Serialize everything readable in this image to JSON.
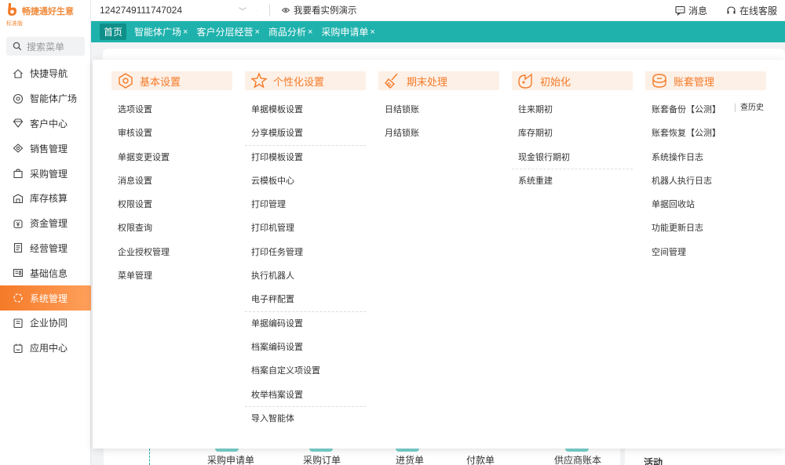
{
  "brand": {
    "name": "畅捷通好生意",
    "edition": "标准版"
  },
  "sidebar": {
    "search_placeholder": "搜索菜单",
    "items": [
      {
        "label": "快捷导航",
        "icon": "home-icon"
      },
      {
        "label": "智能体广场",
        "icon": "agent-icon"
      },
      {
        "label": "客户中心",
        "icon": "diamond-icon"
      },
      {
        "label": "销售管理",
        "icon": "sales-icon"
      },
      {
        "label": "采购管理",
        "icon": "bag-icon"
      },
      {
        "label": "库存核算",
        "icon": "warehouse-icon"
      },
      {
        "label": "资金管理",
        "icon": "money-icon"
      },
      {
        "label": "经营管理",
        "icon": "document-icon"
      },
      {
        "label": "基础信息",
        "icon": "info-card-icon"
      },
      {
        "label": "系统管理",
        "icon": "system-icon",
        "active": true
      },
      {
        "label": "企业协同",
        "icon": "collab-icon"
      },
      {
        "label": "应用中心",
        "icon": "app-icon"
      }
    ]
  },
  "topbar": {
    "account": "1242749111747024",
    "demo": "我要看实例演示",
    "messages": "消息",
    "support": "在线客服"
  },
  "tabs": [
    {
      "label": "首页",
      "closable": false
    },
    {
      "label": "智能体广场",
      "closable": true
    },
    {
      "label": "客户分层经营",
      "closable": true
    },
    {
      "label": "商品分析",
      "closable": true
    },
    {
      "label": "采购申请单",
      "closable": true
    }
  ],
  "mega_menu": {
    "columns": [
      {
        "title": "基本设置",
        "icon": "gear-badge-icon",
        "items": [
          "选项设置",
          "审核设置",
          "单据变更设置",
          "消息设置",
          "权限设置",
          "权限查询",
          "企业授权管理",
          "菜单管理"
        ]
      },
      {
        "title": "个性化设置",
        "icon": "star-brush-icon",
        "items": [
          "单据模板设置",
          "分享模版设置",
          "打印模板设置",
          "云模板中心",
          "打印管理",
          "打印机管理",
          "打印任务管理",
          "执行机器人",
          "电子秤配置",
          "单据编码设置",
          "档案编码设置",
          "档案自定义项设置",
          "枚举档案设置",
          "导入智能体"
        ]
      },
      {
        "title": "期末处理",
        "icon": "broom-icon",
        "items": [
          "日结锁账",
          "月结锁账"
        ]
      },
      {
        "title": "初始化",
        "icon": "init-icon",
        "items": [
          "往来期初",
          "库存期初",
          "现金银行期初",
          "系统重建"
        ]
      },
      {
        "title": "账套管理",
        "icon": "account-set-icon",
        "items": [
          "账套备份【公测】",
          "账套恢复【公测】",
          "系统操作日志",
          "机器人执行日志",
          "单据回收站",
          "功能更新日志",
          "空间管理"
        ]
      }
    ],
    "aside_link": "查历史"
  },
  "bottom_row": {
    "items": [
      "采购申请单",
      "采购订单",
      "进货单",
      "付款单",
      "供应商账本"
    ],
    "side_label": "活动"
  },
  "colors": {
    "accent": "#f57a28",
    "teal": "#1fb2ad"
  }
}
